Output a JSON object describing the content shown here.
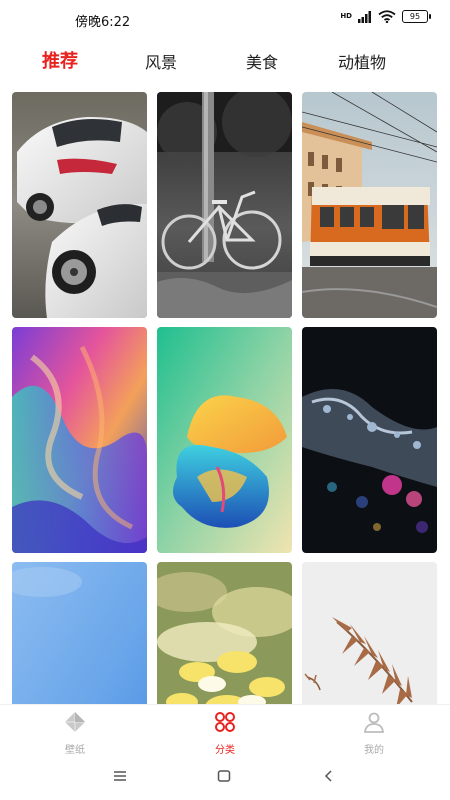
{
  "status": {
    "time": "傍晚6:22",
    "network": "HD",
    "battery": "95"
  },
  "tabs": [
    {
      "label": "推荐",
      "active": true
    },
    {
      "label": "风景",
      "active": false
    },
    {
      "label": "美食",
      "active": false
    },
    {
      "label": "动植物",
      "active": false
    }
  ],
  "wallpapers": [
    {
      "subject": "white sports cars"
    },
    {
      "subject": "bicycle black and white"
    },
    {
      "subject": "orange tram"
    },
    {
      "subject": "colorful abstract waves"
    },
    {
      "subject": "yellow and teal flower"
    },
    {
      "subject": "crystal bokeh"
    },
    {
      "subject": "blue sky"
    },
    {
      "subject": "yellow flowers"
    },
    {
      "subject": "dried fern leaf"
    }
  ],
  "bottom_nav": [
    {
      "label": "壁纸",
      "icon": "wallpaper-icon",
      "active": false
    },
    {
      "label": "分类",
      "icon": "category-icon",
      "active": true
    },
    {
      "label": "我的",
      "icon": "profile-icon",
      "active": false
    }
  ],
  "colors": {
    "accent": "#e8231f",
    "inactive": "#aaaaaa"
  }
}
